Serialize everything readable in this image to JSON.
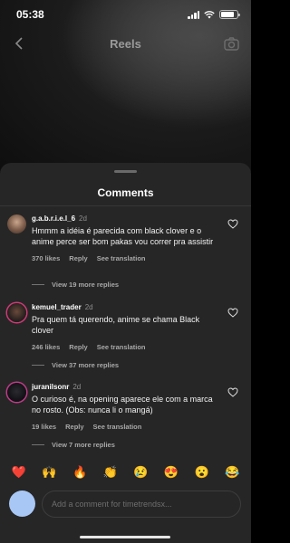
{
  "status_bar": {
    "time": "05:38"
  },
  "header": {
    "title": "Reels",
    "back_icon": "chevron-left-icon",
    "camera_icon": "camera-icon"
  },
  "sheet": {
    "title": "Comments"
  },
  "comments": [
    {
      "user": "g.a.b.r.i.e.l_6",
      "time": "2d",
      "text": "Hmmm a idéia é parecida com black clover e o anime perce ser bom pakas vou correr pra assistir",
      "likes": "370 likes",
      "reply": "Reply",
      "translate": "See translation",
      "more_replies": "View 19 more replies"
    },
    {
      "user": "kemuel_trader",
      "time": "2d",
      "text": "Pra quem tá querendo, anime se chama Black clover",
      "likes": "246 likes",
      "reply": "Reply",
      "translate": "See translation",
      "more_replies": "View 37 more replies"
    },
    {
      "user": "juranilsonr",
      "time": "2d",
      "text": "O curioso é, na opening aparece ele com a marca no rosto. (Obs: nunca li o mangá)",
      "likes": "19 likes",
      "reply": "Reply",
      "translate": "See translation",
      "more_replies": "View 7 more replies"
    }
  ],
  "emoji_bar": [
    "❤️",
    "🙌",
    "🔥",
    "👏",
    "😢",
    "😍",
    "😮",
    "😂"
  ],
  "composer": {
    "placeholder": "Add a comment for timetrendsx..."
  },
  "colors": {
    "sheet_bg": "#262626",
    "avatar_me": "#a8c7f5",
    "muted_text": "#a8a8a8"
  }
}
